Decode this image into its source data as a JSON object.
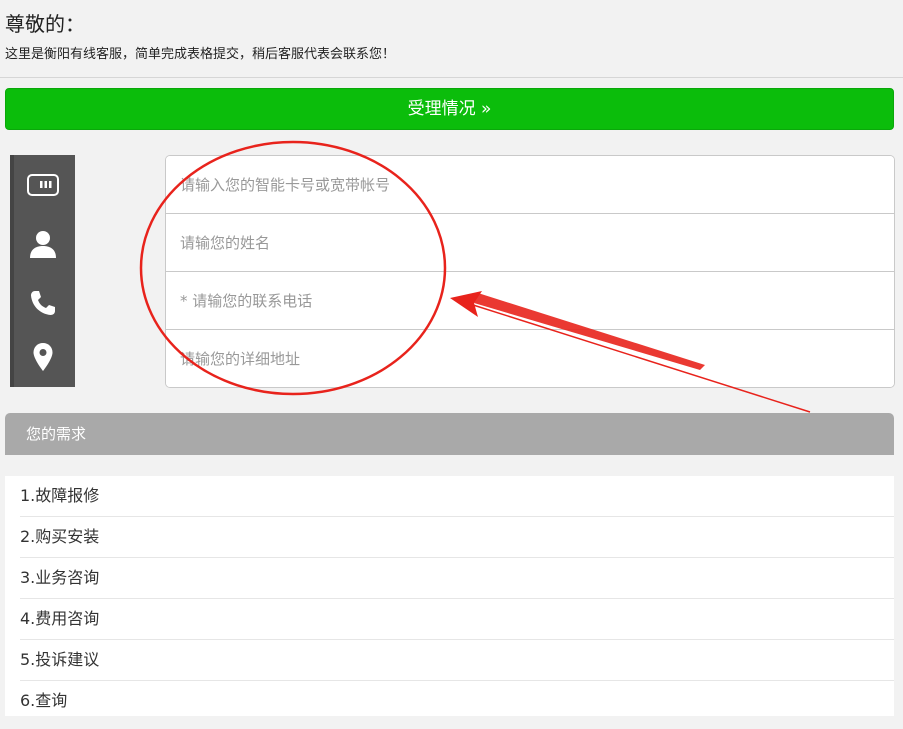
{
  "header": {
    "greeting": "尊敬的：",
    "intro": "这里是衡阳有线客服，简单完成表格提交，稍后客服代表会联系您！"
  },
  "status_button": {
    "label": "受理情况 »",
    "color": "#0bbd0b"
  },
  "form": {
    "fields": [
      {
        "placeholder": "请输入您的智能卡号或宽带帐号",
        "value": "",
        "icon": "card-icon"
      },
      {
        "placeholder": "请输您的姓名",
        "value": "",
        "icon": "person-icon"
      },
      {
        "placeholder": "* 请输您的联系电话",
        "value": "",
        "icon": "phone-icon"
      },
      {
        "placeholder": "请输您的详细地址",
        "value": "",
        "icon": "location-pin-icon"
      }
    ]
  },
  "needs": {
    "title": "您的需求",
    "options": [
      "1.故障报修",
      "2.购买安装",
      "3.业务咨询",
      "4.费用咨询",
      "5.投诉建议",
      "6.查询"
    ]
  },
  "annotation": {
    "color": "#e8231c",
    "shapes": [
      "ellipse",
      "arrow"
    ]
  }
}
